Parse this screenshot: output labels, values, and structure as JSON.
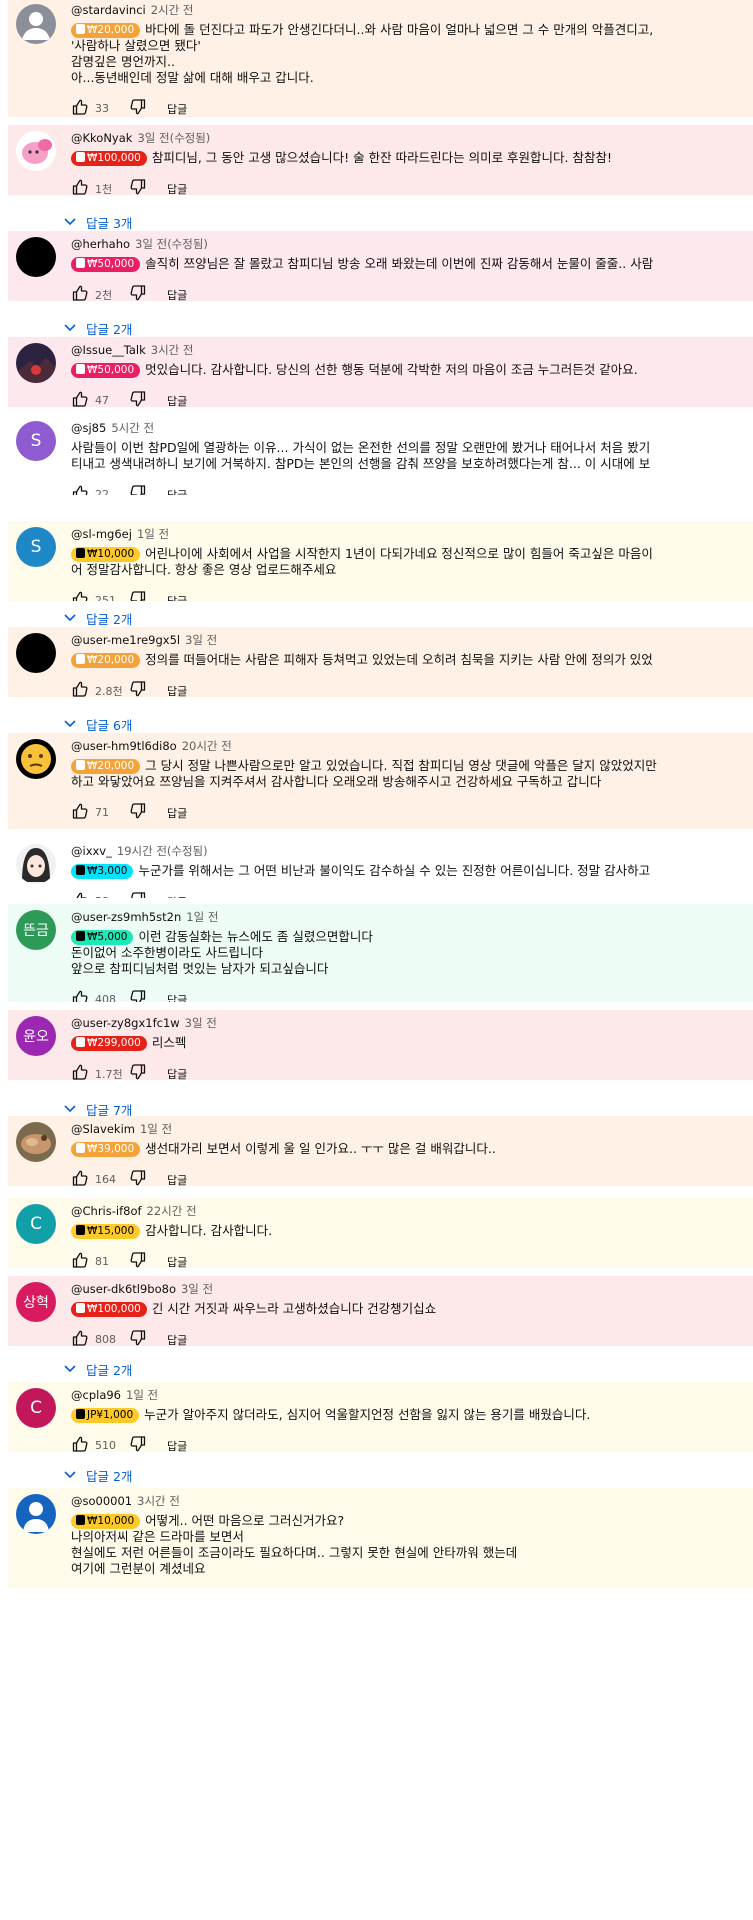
{
  "comments": [
    {
      "author": "@stardavinci",
      "time": "2시간 전",
      "amount": "₩20,000",
      "tier": "orange",
      "lines": [
        "바다에 돌 던진다고 파도가 안생긴다더니..와 사람 마음이 얼마나 넓으면 그 수 만개의 악플견디고,",
        "'사람하나 살렸으면 됐다'",
        "감명깊은 명언까지..",
        "아...동년배인데 정말 삶에 대해 배우고 갑니다."
      ],
      "likes": "33",
      "reply_label": "답글",
      "bg": "#fff1e5",
      "avatar": {
        "type": "default"
      }
    },
    {
      "author": "@KkoNyak",
      "time": "3일 전(수정됨)",
      "amount": "₩100,000",
      "tier": "red",
      "lines": [
        "참피디님, 그 동안 고생 많으셨습니다! 술 한잔 따라드린다는 의미로 후원합니다. 참참참!"
      ],
      "likes": "1천",
      "reply_label": "답글",
      "bg": "#fde8ea",
      "avatar": {
        "type": "pink"
      },
      "replies": "답글 3개"
    },
    {
      "author": "@herhaho",
      "time": "3일 전(수정됨)",
      "amount": "₩50,000",
      "tier": "magenta",
      "lines": [
        "솔직히 쯔양님은 잘 몰랐고 참피디님 방송 오래 봐왔는데 이번에 진짜 감동해서 눈물이 줄줄.. 사람"
      ],
      "likes": "2천",
      "reply_label": "답글",
      "bg": "#fde8ee",
      "avatar": {
        "type": "black"
      },
      "replies": "답글 2개"
    },
    {
      "author": "@Issue__Talk",
      "time": "3시간 전",
      "amount": "₩50,000",
      "tier": "magenta",
      "lines": [
        "멋있습니다. 감사합니다. 당신의 선한 행동 덕분에 각박한 저의 마음이 조금 누그러든것 같아요."
      ],
      "likes": "47",
      "reply_label": "답글",
      "bg": "#fde8ee",
      "avatar": {
        "type": "scene"
      }
    },
    {
      "author": "@sj85",
      "time": "5시간 전",
      "amount": "",
      "tier": "",
      "lines": [
        "사람들이 이번 참PD일에 열광하는 이유... 가식이 없는 온전한 선의를 정말 오랜만에 봤거나 태어나서 처음 봤기",
        "티내고 생색내려하니 보기에 거북하지. 참PD는 본인의 선행을 감춰 쯔양을 보호하려했다는게 참... 이 시대에 보"
      ],
      "likes": "22",
      "reply_label": "답글",
      "bg": "#ffffff",
      "avatar": {
        "type": "letter",
        "letter": "S",
        "color": "#8e5bd1"
      }
    },
    {
      "author": "@sl-mg6ej",
      "time": "1일 전",
      "amount": "₩10,000",
      "tier": "yellow",
      "lines": [
        "어린나이에 사회에서 사업을 시작한지 1년이 다되가네요 정신적으로 많이 힘들어 죽고싶은 마음이",
        "어 정말감사합니다. 항상 좋은 영상 업로드해주세요"
      ],
      "likes": "251",
      "reply_label": "답글",
      "bg": "#fffbea",
      "avatar": {
        "type": "letter",
        "letter": "S",
        "color": "#1e88c7"
      },
      "replies": "답글 2개"
    },
    {
      "author": "@user-me1re9gx5l",
      "time": "3일 전",
      "amount": "₩20,000",
      "tier": "orange",
      "lines": [
        "정의를 떠들어대는 사람은 피해자 등쳐먹고 있었는데 오히려 침묵을 지키는 사람 안에 정의가 있었"
      ],
      "likes": "2.8천",
      "reply_label": "답글",
      "bg": "#fff1e5",
      "avatar": {
        "type": "black"
      },
      "replies": "답글 6개"
    },
    {
      "author": "@user-hm9tl6di8o",
      "time": "20시간 전",
      "amount": "₩20,000",
      "tier": "orange",
      "lines": [
        "그 당시 정말 나쁜사람으로만 알고 있었습니다. 직접 참피디님 영상 댓글에 악플은 달지 않았었지만",
        "하고 와닿았어요 쯔양님을 지켜주셔서 감사합니다 오래오래 방송해주시고 건강하세요 구독하고 갑니다"
      ],
      "likes": "71",
      "reply_label": "답글",
      "bg": "#fff1e5",
      "avatar": {
        "type": "emoji"
      }
    },
    {
      "author": "@ixxv_",
      "time": "19시간 전(수정됨)",
      "amount": "₩3,000",
      "tier": "cyan",
      "lines": [
        "누군가를 위해서는 그 어떤 비난과 불이익도 감수하실 수 있는 진정한 어른이십니다. 정말 감사하고"
      ],
      "likes": "58",
      "reply_label": "답글",
      "bg": "#ffffff",
      "avatar": {
        "type": "anime"
      }
    },
    {
      "author": "@user-zs9mh5st2n",
      "time": "1일 전",
      "amount": "₩5,000",
      "tier": "green",
      "lines": [
        "이런 감동실화는 뉴스에도 좀 실렸으면합니다",
        "돈이없어 소주한병이라도 사드립니다",
        "앞으로 참피디님처럼 멋있는 남자가 되고싶습니다"
      ],
      "likes": "408",
      "reply_label": "답글",
      "bg": "#eefcf6",
      "avatar": {
        "type": "letter",
        "letter": "뜬금",
        "color": "#2e9a57"
      }
    },
    {
      "author": "@user-zy8gx1fc1w",
      "time": "3일 전",
      "amount": "₩299,000",
      "tier": "red",
      "lines": [
        "리스펙"
      ],
      "likes": "1.7천",
      "reply_label": "답글",
      "bg": "#fde8ea",
      "avatar": {
        "type": "letter",
        "letter": "윤오",
        "color": "#9c27b0"
      },
      "replies": "답글 7개"
    },
    {
      "author": "@Slavekim",
      "time": "1일 전",
      "amount": "₩39,000",
      "tier": "orange",
      "lines": [
        "생선대가리 보면서 이렇게 울 일 인가요.. ㅜㅜ 많은 걸 배워갑니다.."
      ],
      "likes": "164",
      "reply_label": "답글",
      "bg": "#fff1e5",
      "avatar": {
        "type": "food"
      }
    },
    {
      "author": "@Chris-if8of",
      "time": "22시간 전",
      "amount": "₩15,000",
      "tier": "yellow",
      "lines": [
        "감사합니다. 감사합니다."
      ],
      "likes": "81",
      "reply_label": "답글",
      "bg": "#fffbea",
      "avatar": {
        "type": "letter",
        "letter": "C",
        "color": "#12a0a8"
      }
    },
    {
      "author": "@user-dk6tl9bo8o",
      "time": "3일 전",
      "amount": "₩100,000",
      "tier": "red",
      "lines": [
        "긴 시간 거짓과 싸우느라 고생하셨습니다 건강챙기십쇼"
      ],
      "likes": "808",
      "reply_label": "답글",
      "bg": "#fde8ea",
      "avatar": {
        "type": "letter",
        "letter": "상혁",
        "color": "#d81b60"
      },
      "replies": "답글 2개"
    },
    {
      "author": "@cpla96",
      "time": "1일 전",
      "amount": "JP¥1,000",
      "tier": "yellow",
      "lines": [
        "누군가 알아주지 않더라도, 심지어 억울할지언정 선함을 잃지 않는 용기를 배웠습니다."
      ],
      "likes": "510",
      "reply_label": "답글",
      "bg": "#fffbea",
      "avatar": {
        "type": "letter",
        "letter": "C",
        "color": "#c2185b"
      },
      "replies": "답글 2개"
    },
    {
      "author": "@so00001",
      "time": "3시간 전",
      "amount": "₩10,000",
      "tier": "yellow",
      "lines": [
        "어떻게.. 어떤 마음으로 그러신거가요?",
        "나의아저씨 같은 드라마를 보면서",
        "현실에도 저런 어른들이 조금이라도 필요하다며.. 그렇지 못한 현실에 안타까워 했는데",
        "여기에 그런분이 계셨네요"
      ],
      "likes": "",
      "reply_label": "답글",
      "bg": "#fffbea",
      "avatar": {
        "type": "person"
      }
    }
  ],
  "tier_colors": {
    "orange": {
      "chip": "#f4a33a",
      "text": "#ffffff",
      "badge": "#c0462a"
    },
    "red": {
      "chip": "#e62117",
      "text": "#ffffff",
      "badge": "#ffffff"
    },
    "magenta": {
      "chip": "#e91e63",
      "text": "#ffffff",
      "badge": "#ffffff"
    },
    "yellow": {
      "chip": "#ffca28",
      "text": "#000000",
      "badge": "#4a3500"
    },
    "cyan": {
      "chip": "#00e5ff",
      "text": "#000000",
      "badge": "#004a55"
    },
    "green": {
      "chip": "#1de9b6",
      "text": "#000000",
      "badge": "#004a38"
    }
  }
}
